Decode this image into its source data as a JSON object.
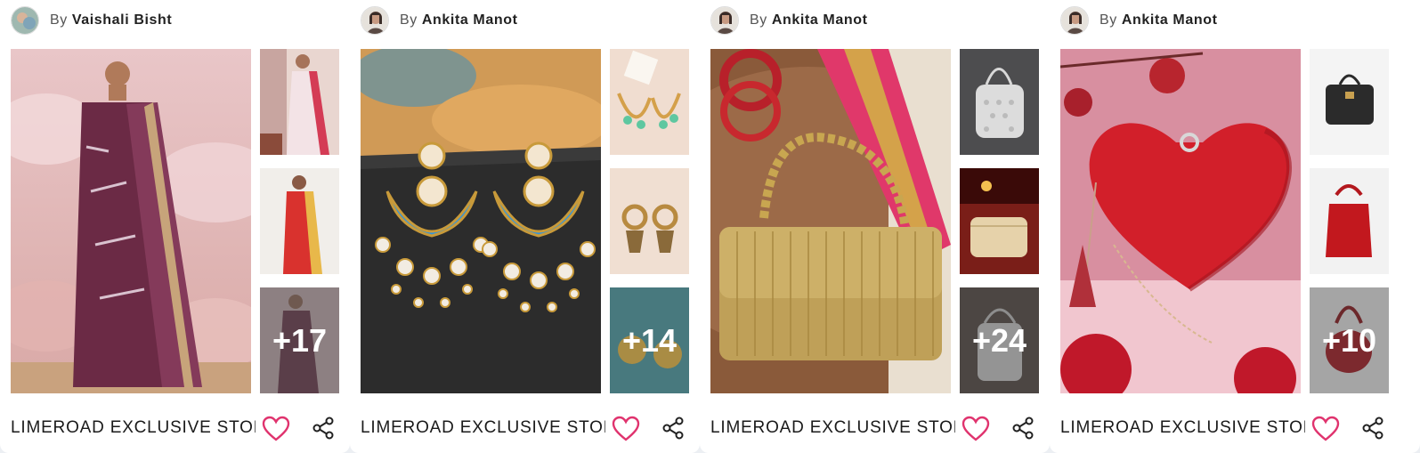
{
  "colors": {
    "heart": "#e0336e",
    "overlay_text": "#ffffff"
  },
  "cards": [
    {
      "by_label": "By",
      "author": "Vaishali Bisht",
      "more_count": "+17",
      "store_name": "LIMEROAD EXCLUSIVE STOR",
      "like_icon": "heart-icon",
      "share_icon": "share-icon"
    },
    {
      "by_label": "By",
      "author": "Ankita Manot",
      "more_count": "+14",
      "store_name": "LIMEROAD EXCLUSIVE STOR",
      "like_icon": "heart-icon",
      "share_icon": "share-icon"
    },
    {
      "by_label": "By",
      "author": "Ankita Manot",
      "more_count": "+24",
      "store_name": "LIMEROAD EXCLUSIVE STOR",
      "like_icon": "heart-icon",
      "share_icon": "share-icon"
    },
    {
      "by_label": "By",
      "author": "Ankita Manot",
      "more_count": "+10",
      "store_name": "LIMEROAD EXCLUSIVE STOR",
      "like_icon": "heart-icon",
      "share_icon": "share-icon"
    }
  ]
}
